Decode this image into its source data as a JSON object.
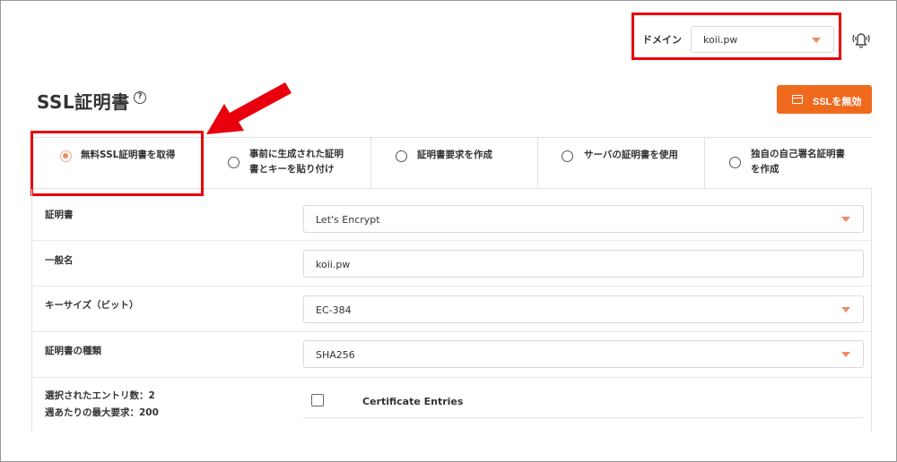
{
  "header": {
    "domain_label": "ドメイン",
    "domain_value": "koii.pw"
  },
  "page": {
    "title": "SSL証明書",
    "help_glyph": "?",
    "disable_button": "SSLを無効"
  },
  "tabs": [
    {
      "label_line1": "無料SSL証明書を取得",
      "label_line2": "",
      "active": true
    },
    {
      "label_line1": "事前に生成された証明",
      "label_line2": "書とキーを貼り付け",
      "active": false
    },
    {
      "label_line1": "証明書要求を作成",
      "label_line2": "",
      "active": false
    },
    {
      "label_line1": "サーバの証明書を使用",
      "label_line2": "",
      "active": false
    },
    {
      "label_line1": "独自の自己署名証明書",
      "label_line2": "を作成",
      "active": false
    }
  ],
  "form": {
    "certificate": {
      "label": "証明書",
      "value": "Let's Encrypt"
    },
    "common_name": {
      "label": "一般名",
      "value": "koii.pw"
    },
    "key_size": {
      "label": "キーサイズ（ビット）",
      "value": "EC-384"
    },
    "cert_type": {
      "label": "証明書の種類",
      "value": "SHA256"
    },
    "entries": {
      "selected_label": "選択されたエントリ数：2",
      "weekly_label": "週あたりの最大要求：200",
      "title": "Certificate Entries"
    }
  },
  "colors": {
    "accent": "#f06a1d",
    "caret": "#f08b66",
    "annotation_red": "#e8000c"
  },
  "icons": {
    "bell": "bell-ringing-icon",
    "help": "question-circle-icon",
    "button": "code-window-icon"
  }
}
